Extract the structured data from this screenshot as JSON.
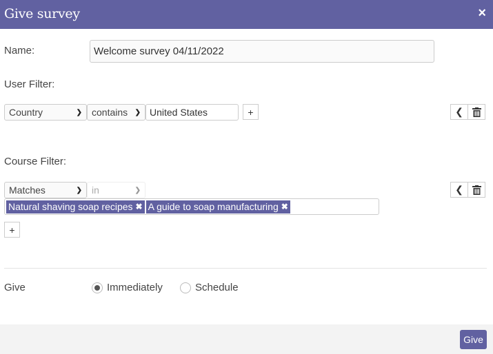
{
  "dialog": {
    "title": "Give survey",
    "close_icon": "×"
  },
  "name": {
    "label": "Name:",
    "value": "Welcome survey 04/11/2022"
  },
  "user_filter": {
    "label": "User Filter:",
    "field": "Country",
    "operator": "contains",
    "value": "United States",
    "add_label": "+",
    "back_icon": "‹",
    "delete_icon": "trash"
  },
  "course_filter": {
    "label": "Course Filter:",
    "field": "Matches",
    "operator": "in",
    "tags": [
      {
        "label": "Natural shaving soap recipes"
      },
      {
        "label": "A guide to soap manufacturing"
      }
    ],
    "remove_icon": "✖",
    "add_label": "+"
  },
  "give": {
    "label": "Give",
    "options": [
      {
        "label": "Immediately",
        "selected": true
      },
      {
        "label": "Schedule",
        "selected": false
      }
    ]
  },
  "footer": {
    "give_button": "Give"
  },
  "colors": {
    "accent": "#6161a1",
    "footer_bg": "#f3f3f3"
  }
}
